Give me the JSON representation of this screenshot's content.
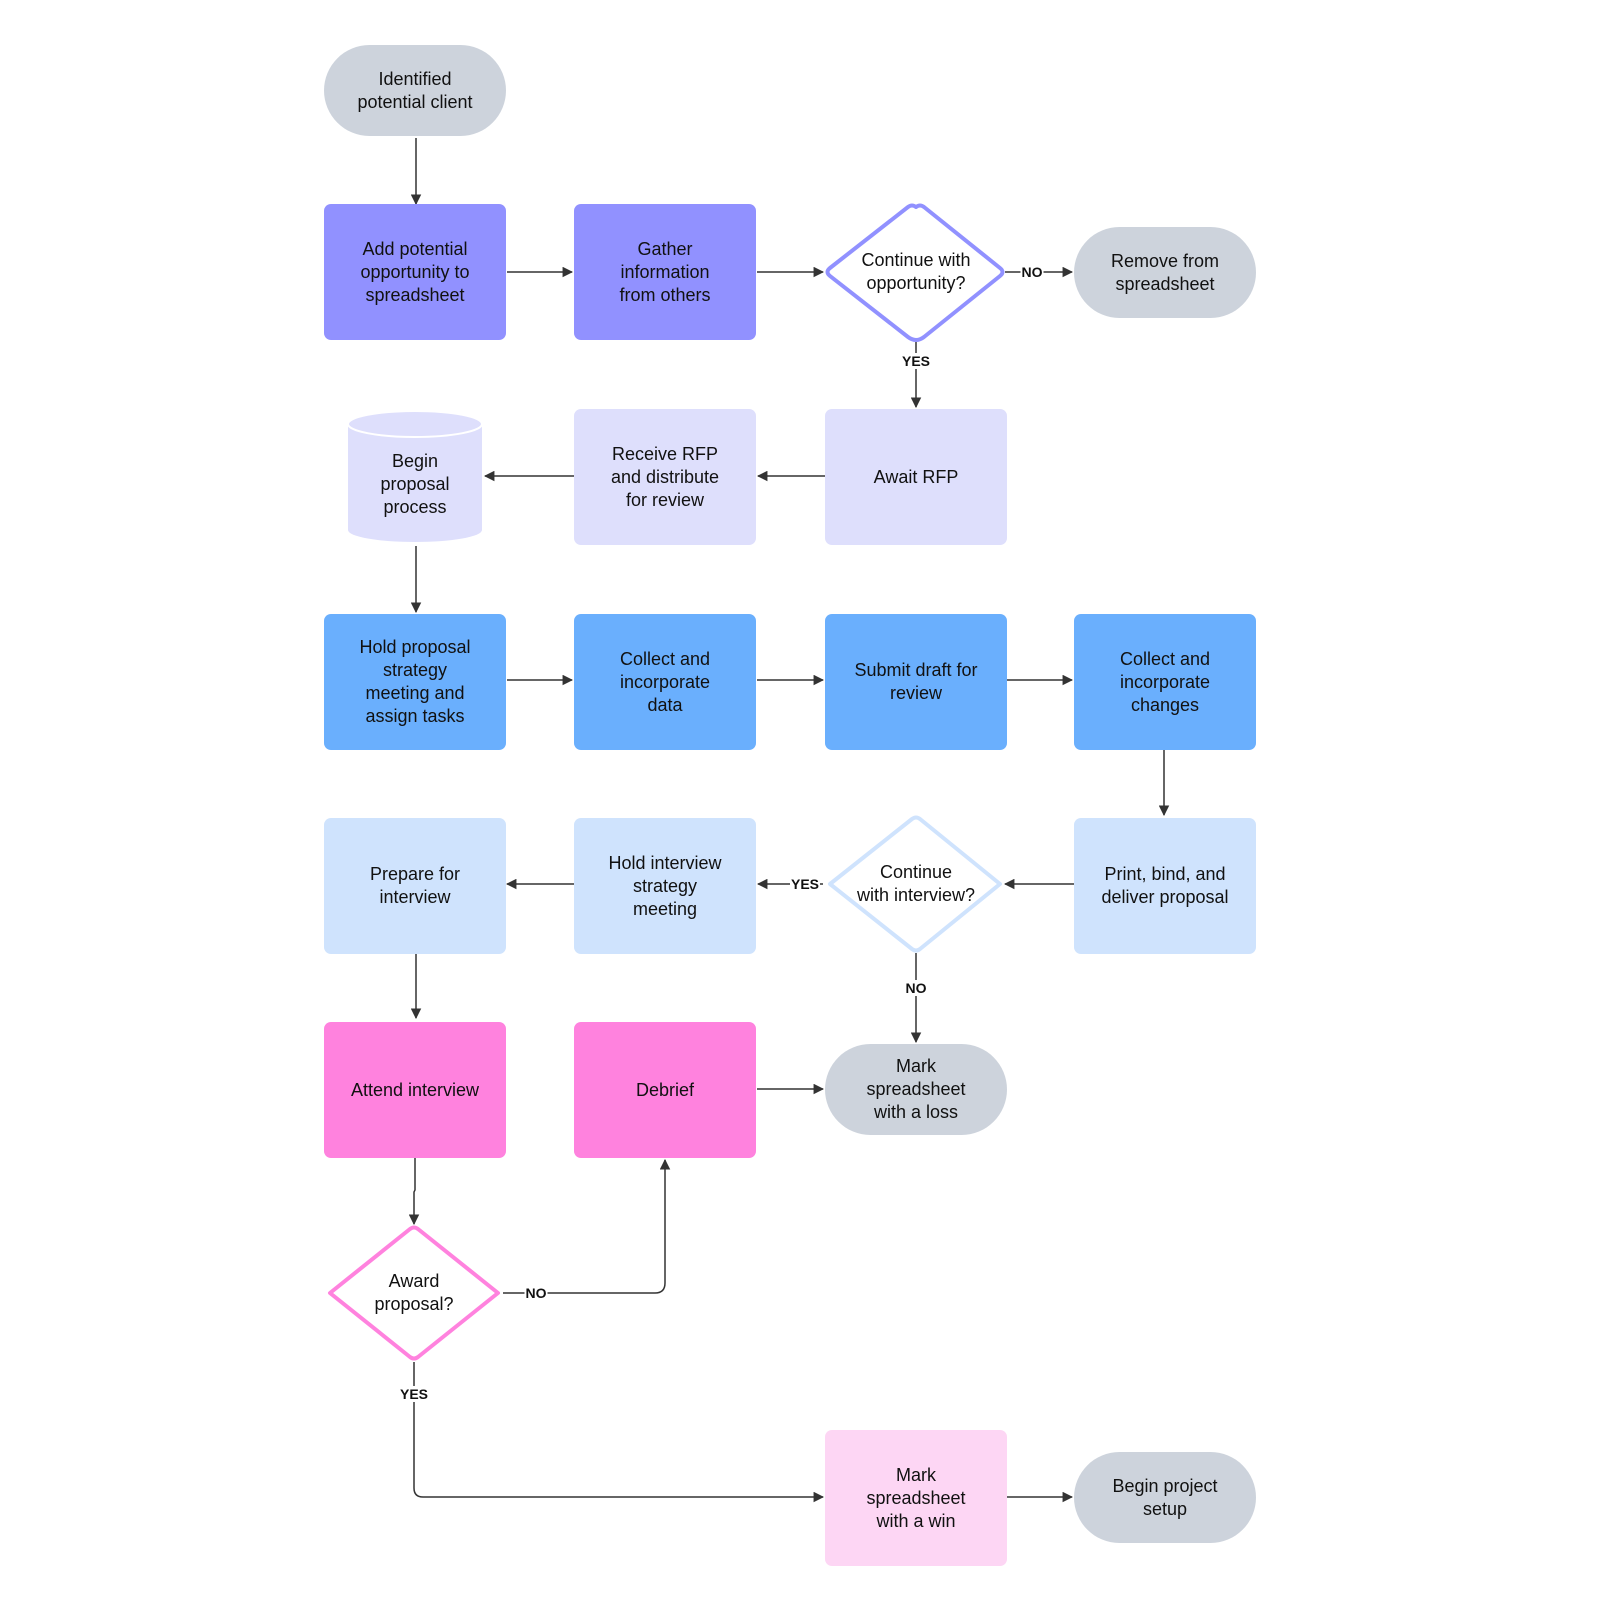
{
  "diagram": {
    "colors": {
      "purple": "#9191ff",
      "lavender": "#dedffc",
      "blue": "#6aaffd",
      "lightblue": "#cfe3fd",
      "pink": "#ff82de",
      "lightpink": "#fdd6f4",
      "gray": "#cdd3dc",
      "purple_stroke": "#9191ff",
      "lightblue_stroke": "#cfe3fd",
      "pink_stroke": "#ff82de",
      "edge": "#333333"
    },
    "nodes": {
      "identified_client": "Identified\npotential client",
      "add_opportunity": "Add potential\nopportunity to\nspreadsheet",
      "gather_info": "Gather\ninformation\nfrom others",
      "continue_opportunity": "Continue with\nopportunity?",
      "remove_spreadsheet": "Remove from\nspreadsheet",
      "await_rfp": "Await RFP",
      "receive_rfp": "Receive RFP\nand distribute\nfor review",
      "begin_proposal": "Begin\nproposal\nprocess",
      "hold_proposal_meeting": "Hold proposal\nstrategy\nmeeting and\nassign tasks",
      "collect_data": "Collect and\nincorporate\ndata",
      "submit_draft": "Submit draft for\nreview",
      "collect_changes": "Collect and\nincorporate\nchanges",
      "print_deliver": "Print, bind, and\ndeliver proposal",
      "continue_interview": "Continue\nwith interview?",
      "hold_interview_meeting": "Hold interview\nstrategy\nmeeting",
      "prepare_interview": "Prepare for\ninterview",
      "attend_interview": "Attend interview",
      "debrief": "Debrief",
      "mark_loss": "Mark\nspreadsheet\nwith a loss",
      "award_proposal": "Award\nproposal?",
      "mark_win": "Mark\nspreadsheet\nwith a win",
      "begin_project": "Begin project\nsetup"
    },
    "edge_labels": {
      "opportunity_no": "NO",
      "opportunity_yes": "YES",
      "interview_yes": "YES",
      "interview_no": "NO",
      "award_no": "NO",
      "award_yes": "YES"
    }
  }
}
